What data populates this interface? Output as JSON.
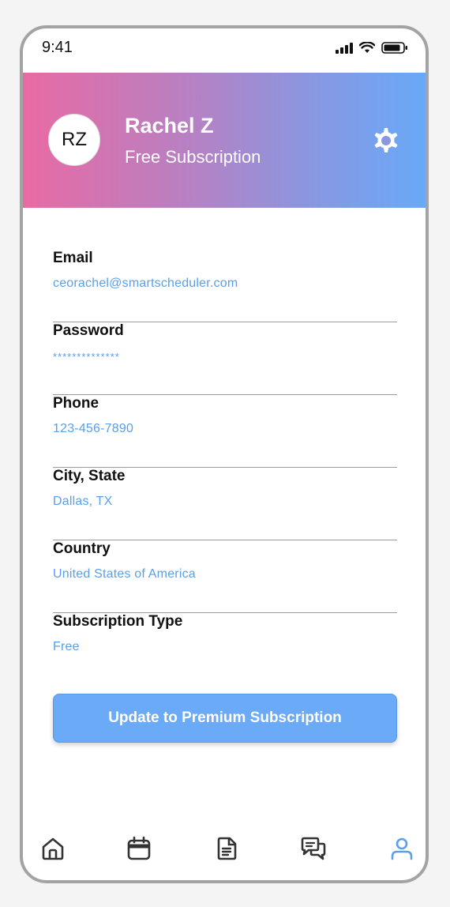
{
  "status_bar": {
    "time": "9:41"
  },
  "profile": {
    "initials": "RZ",
    "name": "Rachel Z",
    "subscription_label": "Free Subscription"
  },
  "fields": [
    {
      "label": "Email",
      "value": "ceorachel@smartscheduler.com"
    },
    {
      "label": "Password",
      "value": "**************"
    },
    {
      "label": "Phone",
      "value": "123-456-7890"
    },
    {
      "label": "City, State",
      "value": "Dallas, TX"
    },
    {
      "label": "Country",
      "value": "United States of America"
    },
    {
      "label": "Subscription Type",
      "value": "Free"
    }
  ],
  "actions": {
    "premium_label": "Update to Premium Subscription"
  },
  "nav": {
    "items": [
      {
        "icon": "home-icon"
      },
      {
        "icon": "calendar-icon"
      },
      {
        "icon": "document-icon"
      },
      {
        "icon": "chat-icon"
      },
      {
        "icon": "profile-icon",
        "active": true
      }
    ]
  },
  "colors": {
    "accent": "#6aaaf6",
    "gradient_start": "#e96aa3",
    "gradient_end": "#68a9f8",
    "value_text": "#5a9fe8",
    "nav_inactive": "#333333"
  }
}
